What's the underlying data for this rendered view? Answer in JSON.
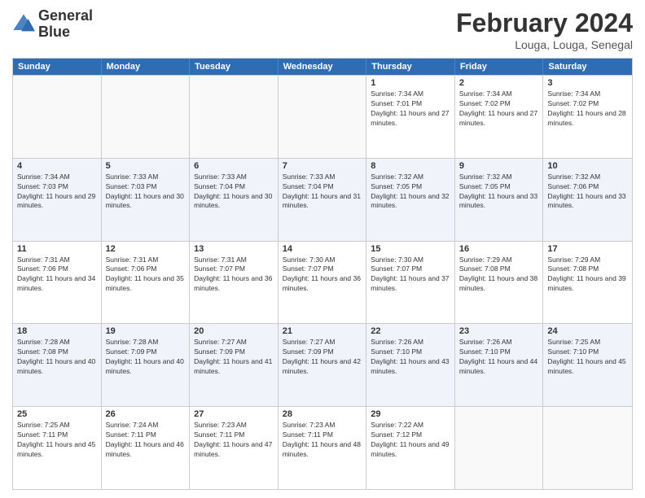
{
  "logo": {
    "line1": "General",
    "line2": "Blue"
  },
  "title": {
    "month_year": "February 2024",
    "location": "Louga, Louga, Senegal"
  },
  "headers": [
    "Sunday",
    "Monday",
    "Tuesday",
    "Wednesday",
    "Thursday",
    "Friday",
    "Saturday"
  ],
  "rows": [
    [
      {
        "day": "",
        "sunrise": "",
        "sunset": "",
        "daylight": "",
        "empty": true
      },
      {
        "day": "",
        "sunrise": "",
        "sunset": "",
        "daylight": "",
        "empty": true
      },
      {
        "day": "",
        "sunrise": "",
        "sunset": "",
        "daylight": "",
        "empty": true
      },
      {
        "day": "",
        "sunrise": "",
        "sunset": "",
        "daylight": "",
        "empty": true
      },
      {
        "day": "1",
        "sunrise": "Sunrise: 7:34 AM",
        "sunset": "Sunset: 7:01 PM",
        "daylight": "Daylight: 11 hours and 27 minutes.",
        "empty": false
      },
      {
        "day": "2",
        "sunrise": "Sunrise: 7:34 AM",
        "sunset": "Sunset: 7:02 PM",
        "daylight": "Daylight: 11 hours and 27 minutes.",
        "empty": false
      },
      {
        "day": "3",
        "sunrise": "Sunrise: 7:34 AM",
        "sunset": "Sunset: 7:02 PM",
        "daylight": "Daylight: 11 hours and 28 minutes.",
        "empty": false
      }
    ],
    [
      {
        "day": "4",
        "sunrise": "Sunrise: 7:34 AM",
        "sunset": "Sunset: 7:03 PM",
        "daylight": "Daylight: 11 hours and 29 minutes.",
        "empty": false
      },
      {
        "day": "5",
        "sunrise": "Sunrise: 7:33 AM",
        "sunset": "Sunset: 7:03 PM",
        "daylight": "Daylight: 11 hours and 30 minutes.",
        "empty": false
      },
      {
        "day": "6",
        "sunrise": "Sunrise: 7:33 AM",
        "sunset": "Sunset: 7:04 PM",
        "daylight": "Daylight: 11 hours and 30 minutes.",
        "empty": false
      },
      {
        "day": "7",
        "sunrise": "Sunrise: 7:33 AM",
        "sunset": "Sunset: 7:04 PM",
        "daylight": "Daylight: 11 hours and 31 minutes.",
        "empty": false
      },
      {
        "day": "8",
        "sunrise": "Sunrise: 7:32 AM",
        "sunset": "Sunset: 7:05 PM",
        "daylight": "Daylight: 11 hours and 32 minutes.",
        "empty": false
      },
      {
        "day": "9",
        "sunrise": "Sunrise: 7:32 AM",
        "sunset": "Sunset: 7:05 PM",
        "daylight": "Daylight: 11 hours and 33 minutes.",
        "empty": false
      },
      {
        "day": "10",
        "sunrise": "Sunrise: 7:32 AM",
        "sunset": "Sunset: 7:06 PM",
        "daylight": "Daylight: 11 hours and 33 minutes.",
        "empty": false
      }
    ],
    [
      {
        "day": "11",
        "sunrise": "Sunrise: 7:31 AM",
        "sunset": "Sunset: 7:06 PM",
        "daylight": "Daylight: 11 hours and 34 minutes.",
        "empty": false
      },
      {
        "day": "12",
        "sunrise": "Sunrise: 7:31 AM",
        "sunset": "Sunset: 7:06 PM",
        "daylight": "Daylight: 11 hours and 35 minutes.",
        "empty": false
      },
      {
        "day": "13",
        "sunrise": "Sunrise: 7:31 AM",
        "sunset": "Sunset: 7:07 PM",
        "daylight": "Daylight: 11 hours and 36 minutes.",
        "empty": false
      },
      {
        "day": "14",
        "sunrise": "Sunrise: 7:30 AM",
        "sunset": "Sunset: 7:07 PM",
        "daylight": "Daylight: 11 hours and 36 minutes.",
        "empty": false
      },
      {
        "day": "15",
        "sunrise": "Sunrise: 7:30 AM",
        "sunset": "Sunset: 7:07 PM",
        "daylight": "Daylight: 11 hours and 37 minutes.",
        "empty": false
      },
      {
        "day": "16",
        "sunrise": "Sunrise: 7:29 AM",
        "sunset": "Sunset: 7:08 PM",
        "daylight": "Daylight: 11 hours and 38 minutes.",
        "empty": false
      },
      {
        "day": "17",
        "sunrise": "Sunrise: 7:29 AM",
        "sunset": "Sunset: 7:08 PM",
        "daylight": "Daylight: 11 hours and 39 minutes.",
        "empty": false
      }
    ],
    [
      {
        "day": "18",
        "sunrise": "Sunrise: 7:28 AM",
        "sunset": "Sunset: 7:08 PM",
        "daylight": "Daylight: 11 hours and 40 minutes.",
        "empty": false
      },
      {
        "day": "19",
        "sunrise": "Sunrise: 7:28 AM",
        "sunset": "Sunset: 7:09 PM",
        "daylight": "Daylight: 11 hours and 40 minutes.",
        "empty": false
      },
      {
        "day": "20",
        "sunrise": "Sunrise: 7:27 AM",
        "sunset": "Sunset: 7:09 PM",
        "daylight": "Daylight: 11 hours and 41 minutes.",
        "empty": false
      },
      {
        "day": "21",
        "sunrise": "Sunrise: 7:27 AM",
        "sunset": "Sunset: 7:09 PM",
        "daylight": "Daylight: 11 hours and 42 minutes.",
        "empty": false
      },
      {
        "day": "22",
        "sunrise": "Sunrise: 7:26 AM",
        "sunset": "Sunset: 7:10 PM",
        "daylight": "Daylight: 11 hours and 43 minutes.",
        "empty": false
      },
      {
        "day": "23",
        "sunrise": "Sunrise: 7:26 AM",
        "sunset": "Sunset: 7:10 PM",
        "daylight": "Daylight: 11 hours and 44 minutes.",
        "empty": false
      },
      {
        "day": "24",
        "sunrise": "Sunrise: 7:25 AM",
        "sunset": "Sunset: 7:10 PM",
        "daylight": "Daylight: 11 hours and 45 minutes.",
        "empty": false
      }
    ],
    [
      {
        "day": "25",
        "sunrise": "Sunrise: 7:25 AM",
        "sunset": "Sunset: 7:11 PM",
        "daylight": "Daylight: 11 hours and 45 minutes.",
        "empty": false
      },
      {
        "day": "26",
        "sunrise": "Sunrise: 7:24 AM",
        "sunset": "Sunset: 7:11 PM",
        "daylight": "Daylight: 11 hours and 46 minutes.",
        "empty": false
      },
      {
        "day": "27",
        "sunrise": "Sunrise: 7:23 AM",
        "sunset": "Sunset: 7:11 PM",
        "daylight": "Daylight: 11 hours and 47 minutes.",
        "empty": false
      },
      {
        "day": "28",
        "sunrise": "Sunrise: 7:23 AM",
        "sunset": "Sunset: 7:11 PM",
        "daylight": "Daylight: 11 hours and 48 minutes.",
        "empty": false
      },
      {
        "day": "29",
        "sunrise": "Sunrise: 7:22 AM",
        "sunset": "Sunset: 7:12 PM",
        "daylight": "Daylight: 11 hours and 49 minutes.",
        "empty": false
      },
      {
        "day": "",
        "sunrise": "",
        "sunset": "",
        "daylight": "",
        "empty": true
      },
      {
        "day": "",
        "sunrise": "",
        "sunset": "",
        "daylight": "",
        "empty": true
      }
    ]
  ]
}
